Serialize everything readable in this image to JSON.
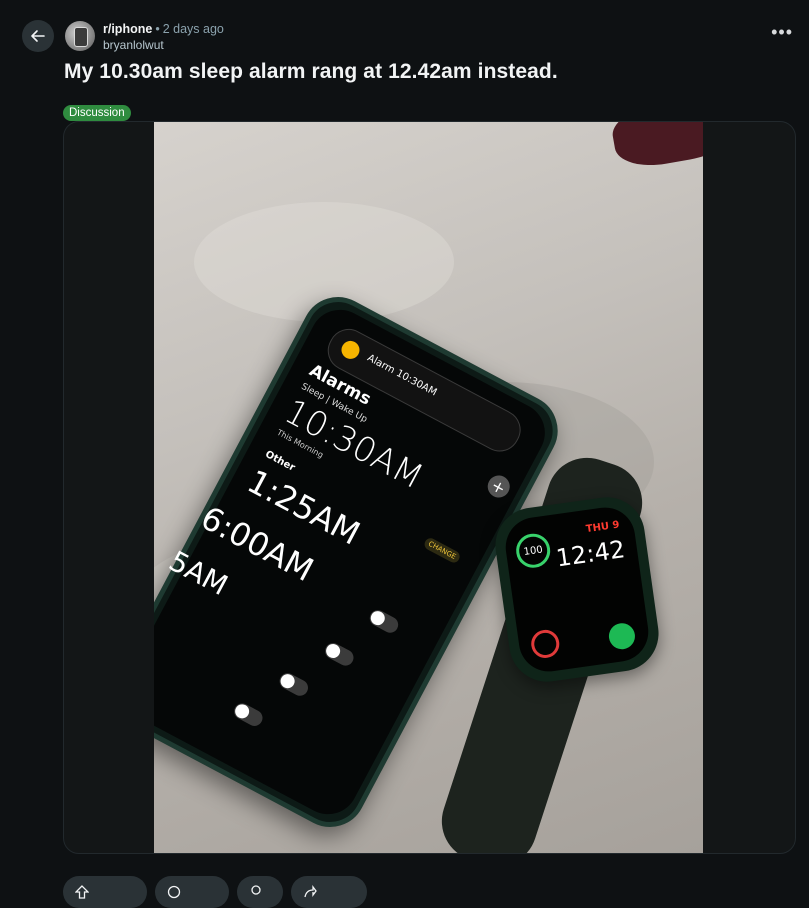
{
  "post": {
    "subreddit": "r/iphone",
    "time_ago": "2 days ago",
    "author": "bryanlolwut",
    "title": "My 10.30am sleep alarm rang at 12.42am instead.",
    "flair": "Discussion"
  },
  "icons": {
    "back": "arrow-left-icon",
    "more": "ellipsis-icon"
  },
  "image_text": {
    "pill": "Alarm 10:30AM",
    "alarms_heading": "Alarms",
    "sleep_label": "Sleep | Wake Up",
    "sleep_time": "10:30AM",
    "this_morning": "This Morning",
    "other_heading": "Other",
    "change": "CHANGE",
    "time_1": "1:25AM",
    "time_2": "6:00AM",
    "time_3": "5AM",
    "watch_day": "THU 9",
    "watch_time": "12:42",
    "watch_ring": "100"
  },
  "colors": {
    "background": "#0e1113",
    "flair": "#2f8c3f",
    "button_bg": "#2a3236"
  }
}
